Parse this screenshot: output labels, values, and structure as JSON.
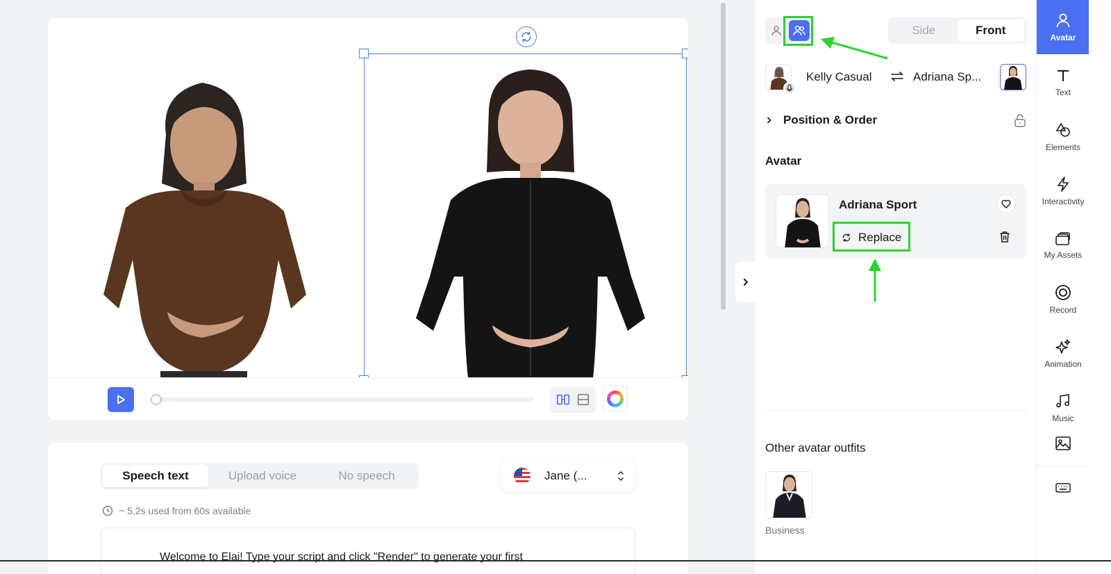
{
  "canvas": {
    "left_avatar_name": "Kelly Casual",
    "right_avatar_name": "Adriana Sport"
  },
  "speech": {
    "tabs": [
      {
        "label": "Speech text",
        "active": true
      },
      {
        "label": "Upload voice",
        "active": false
      },
      {
        "label": "No speech",
        "active": false
      }
    ],
    "voice": "Jane (...",
    "usage": "~ 5.2s used from 60s available",
    "script_text": "Welcome to Elai! Type your script and click \"Render\" to generate your first"
  },
  "panel": {
    "view_toggle": {
      "side": "Side",
      "front": "Front",
      "active": "Front"
    },
    "pair": {
      "left": "Kelly Casual",
      "right": "Adriana Sp..."
    },
    "position_order_title": "Position & Order",
    "avatar_heading": "Avatar",
    "avatar_card": {
      "name": "Adriana Sport",
      "replace_label": "Replace"
    },
    "other_outfits_heading": "Other avatar outfits",
    "outfits": [
      {
        "label": "Business"
      }
    ]
  },
  "rail": {
    "items": [
      {
        "label": "Avatar",
        "icon": "person-icon",
        "active": true
      },
      {
        "label": "Text",
        "icon": "text-icon",
        "active": false
      },
      {
        "label": "Elements",
        "icon": "shapes-icon",
        "active": false
      },
      {
        "label": "Interactivity",
        "icon": "lightning-icon",
        "active": false
      },
      {
        "label": "My Assets",
        "icon": "folder-icon",
        "active": false
      },
      {
        "label": "Record",
        "icon": "record-icon",
        "active": false
      },
      {
        "label": "Animation",
        "icon": "sparkles-icon",
        "active": false
      },
      {
        "label": "Music",
        "icon": "music-icon",
        "active": false
      },
      {
        "label": "",
        "icon": "image-icon",
        "active": false
      },
      {
        "label": "",
        "icon": "keyboard-icon",
        "active": false
      }
    ]
  },
  "colors": {
    "accent": "#4a6ff0",
    "highlight": "#2bd42b",
    "selection": "#4a7ef0"
  }
}
